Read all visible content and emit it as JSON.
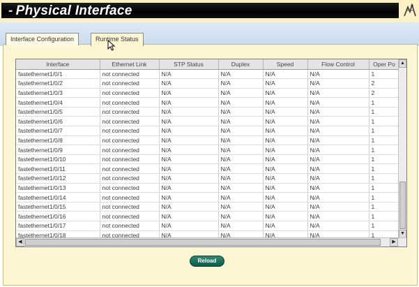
{
  "header": {
    "title": "Physical Interface"
  },
  "tabs": [
    {
      "label": "Interface Configuration"
    },
    {
      "label": "Runtime Status"
    }
  ],
  "table": {
    "columns": [
      "Interface",
      "Ethernet Link",
      "STP Status",
      "Duplex",
      "Speed",
      "Flow Control",
      "Oper Po"
    ],
    "rows": [
      [
        "fastethernet1/0/1",
        "not connected",
        "N/A",
        "N/A",
        "N/A",
        "N/A",
        "1"
      ],
      [
        "fastethernet1/0/2",
        "not connected",
        "N/A",
        "N/A",
        "N/A",
        "N/A",
        "2"
      ],
      [
        "fastethernet1/0/3",
        "not connected",
        "N/A",
        "N/A",
        "N/A",
        "N/A",
        "2"
      ],
      [
        "fastethernet1/0/4",
        "not connected",
        "N/A",
        "N/A",
        "N/A",
        "N/A",
        "1"
      ],
      [
        "fastethernet1/0/5",
        "not connected",
        "N/A",
        "N/A",
        "N/A",
        "N/A",
        "1"
      ],
      [
        "fastethernet1/0/6",
        "not connected",
        "N/A",
        "N/A",
        "N/A",
        "N/A",
        "1"
      ],
      [
        "fastethernet1/0/7",
        "not connected",
        "N/A",
        "N/A",
        "N/A",
        "N/A",
        "1"
      ],
      [
        "fastethernet1/0/8",
        "not connected",
        "N/A",
        "N/A",
        "N/A",
        "N/A",
        "1"
      ],
      [
        "fastethernet1/0/9",
        "not connected",
        "N/A",
        "N/A",
        "N/A",
        "N/A",
        "1"
      ],
      [
        "fastethernet1/0/10",
        "not connected",
        "N/A",
        "N/A",
        "N/A",
        "N/A",
        "1"
      ],
      [
        "fastethernet1/0/11",
        "not connected",
        "N/A",
        "N/A",
        "N/A",
        "N/A",
        "1"
      ],
      [
        "fastethernet1/0/12",
        "not connected",
        "N/A",
        "N/A",
        "N/A",
        "N/A",
        "1"
      ],
      [
        "fastethernet1/0/13",
        "not connected",
        "N/A",
        "N/A",
        "N/A",
        "N/A",
        "1"
      ],
      [
        "fastethernet1/0/14",
        "not connected",
        "N/A",
        "N/A",
        "N/A",
        "N/A",
        "1"
      ],
      [
        "fastethernet1/0/15",
        "not connected",
        "N/A",
        "N/A",
        "N/A",
        "N/A",
        "1"
      ],
      [
        "fastethernet1/0/16",
        "not connected",
        "N/A",
        "N/A",
        "N/A",
        "N/A",
        "1"
      ],
      [
        "fastethernet1/0/17",
        "not connected",
        "N/A",
        "N/A",
        "N/A",
        "N/A",
        "1"
      ],
      [
        "fastethernet1/0/18",
        "not connected",
        "N/A",
        "N/A",
        "N/A",
        "N/A",
        "1"
      ]
    ]
  },
  "actions": {
    "reload_label": "Reload"
  },
  "icons": {
    "logo": "network-logo-icon",
    "cursor": "mouse-cursor-icon"
  },
  "colors": {
    "header_bg": "#000000",
    "panel_bg": "#fdf6d3",
    "band_bg": "#c9daef",
    "button_green": "#0d5a48"
  }
}
